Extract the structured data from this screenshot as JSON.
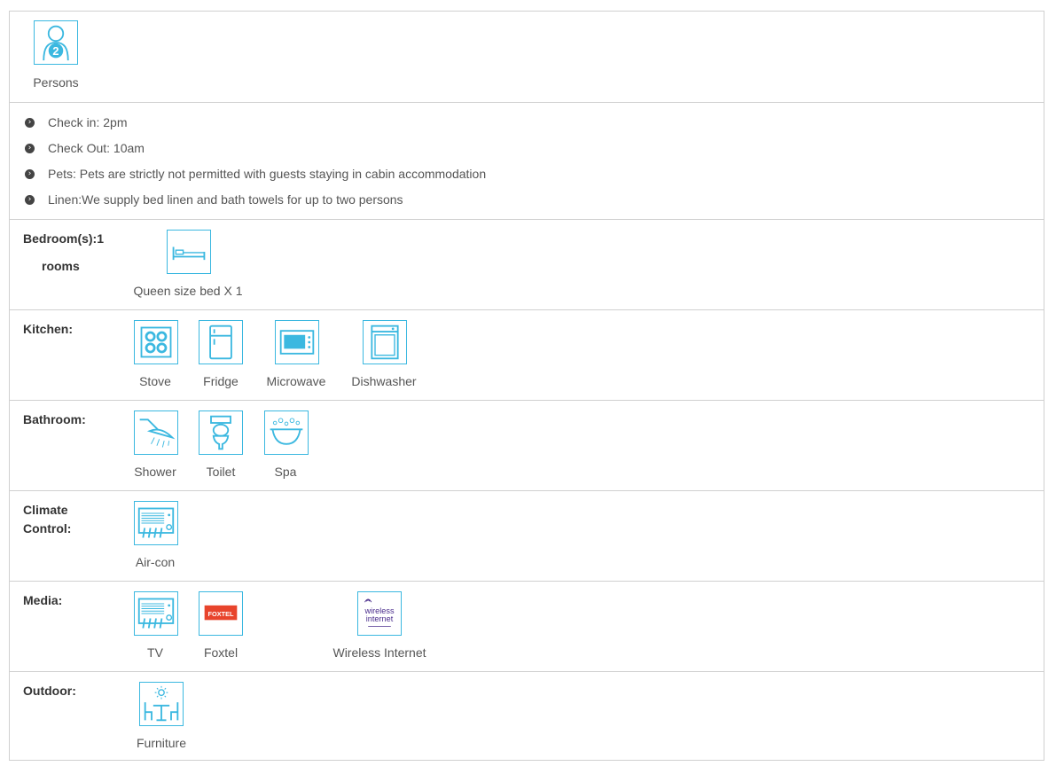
{
  "persons": {
    "count": "2",
    "label": "Persons"
  },
  "info": [
    "Check in: 2pm",
    "Check Out: 10am",
    "Pets: Pets are strictly not permitted with guests staying in cabin accommodation",
    "Linen:We supply bed linen and bath towels for up to two persons"
  ],
  "bedroom": {
    "label_line1": "Bedroom(s):1",
    "label_line2": "rooms",
    "items": [
      "Queen size bed X 1"
    ]
  },
  "kitchen": {
    "label": "Kitchen:",
    "items": [
      "Stove",
      "Fridge",
      "Microwave",
      "Dishwasher"
    ]
  },
  "bathroom": {
    "label": "Bathroom:",
    "items": [
      "Shower",
      "Toilet",
      "Spa"
    ]
  },
  "climate": {
    "label_line1": "Climate",
    "label_line2": "Control:",
    "items": [
      "Air-con"
    ]
  },
  "media": {
    "label": "Media:",
    "items": [
      "TV",
      "Foxtel",
      "Wireless Internet"
    ],
    "foxtel_logo": "FOXTEL",
    "wireless_logo_line1": "wireless",
    "wireless_logo_line2": "internet"
  },
  "outdoor": {
    "label": "Outdoor:",
    "items": [
      "Furniture"
    ]
  },
  "colors": {
    "accent": "#3bb8e0",
    "foxtel": "#e8442c",
    "wireless": "#4a2d8c"
  }
}
